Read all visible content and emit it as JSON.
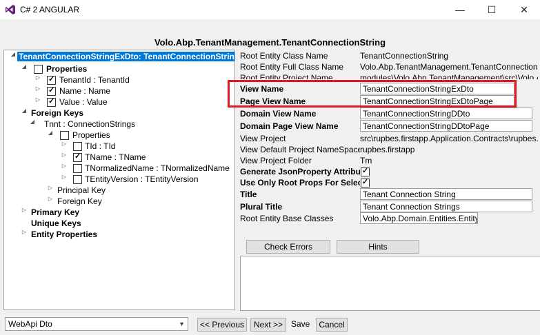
{
  "window": {
    "title": "C# 2 ANGULAR",
    "minimize_icon": "minimize-icon",
    "maximize_icon": "maximize-icon",
    "close_icon": "close-icon"
  },
  "heading": "Volo.Abp.TenantManagement.TenantConnectionString",
  "tree": {
    "root": "TenantConnectionStringExDto: TenantConnectionString",
    "properties": "Properties",
    "prop_items": [
      "TenantId : TenantId",
      "Name : Name",
      "Value : Value"
    ],
    "foreign_keys": "Foreign Keys",
    "tnnt": "Tnnt : ConnectionStrings",
    "sub_properties": "Properties",
    "sub_items": [
      "TId : TId",
      "TName : TName",
      "TNormalizedName : TNormalizedName",
      "TEntityVersion : TEntityVersion"
    ],
    "principal_key": "Principal Key",
    "foreign_key": "Foreign Key",
    "primary_key": "Primary Key",
    "unique_keys": "Unique Keys",
    "entity_properties": "Entity Properties"
  },
  "props": {
    "root_entity_class_name": {
      "label": "Root Entity Class Name",
      "value": "TenantConnectionString"
    },
    "root_entity_full_class_name": {
      "label": "Root Entity Full Class Name",
      "value": "Volo.Abp.TenantManagement.TenantConnectionS"
    },
    "root_entity_project_name": {
      "label": "Root Entity Project Name",
      "value": "modules\\Volo.Abp.TenantManagement\\src\\Volo.A"
    },
    "view_name": {
      "label": "View Name",
      "value": "TenantConnectionStringExDto"
    },
    "page_view_name": {
      "label": "Page View Name",
      "value": "TenantConnectionStringExDtoPage"
    },
    "domain_view_name": {
      "label": "Domain View Name",
      "value": "TenantConnectionStringDDto"
    },
    "domain_page_view_name": {
      "label": "Domain Page View Name",
      "value": "TenantConnectionStringDDtoPage"
    },
    "view_project": {
      "label": "View Project",
      "value": "src\\rupbes.firstapp.Application.Contracts\\rupbes."
    },
    "view_default_project_namespace": {
      "label": "View Default Project NameSpace",
      "value": "rupbes.firstapp"
    },
    "view_project_folder": {
      "label": "View Project Folder",
      "value": "Tm"
    },
    "generate_json_property": {
      "label": "Generate JsonProperty Attribu",
      "checked": true
    },
    "use_only_root_props": {
      "label": "Use Only Root Props For Select",
      "checked": true
    },
    "title": {
      "label": "Title",
      "value": "Tenant Connection String"
    },
    "plural_title": {
      "label": "Plural Title",
      "value": "Tenant Connection Strings"
    },
    "root_entity_base_classes": {
      "label": "Root Entity Base Classes",
      "value": "Volo.Abp.Domain.Entities.Entity"
    }
  },
  "buttons": {
    "check_errors": "Check Errors",
    "hints": "Hints",
    "previous": "<< Previous",
    "next": "Next >>",
    "save": "Save",
    "cancel": "Cancel"
  },
  "footer": {
    "combo_value": "WebApi Dto"
  },
  "colors": {
    "highlight": "#e0191f",
    "selection": "#0078d7"
  }
}
